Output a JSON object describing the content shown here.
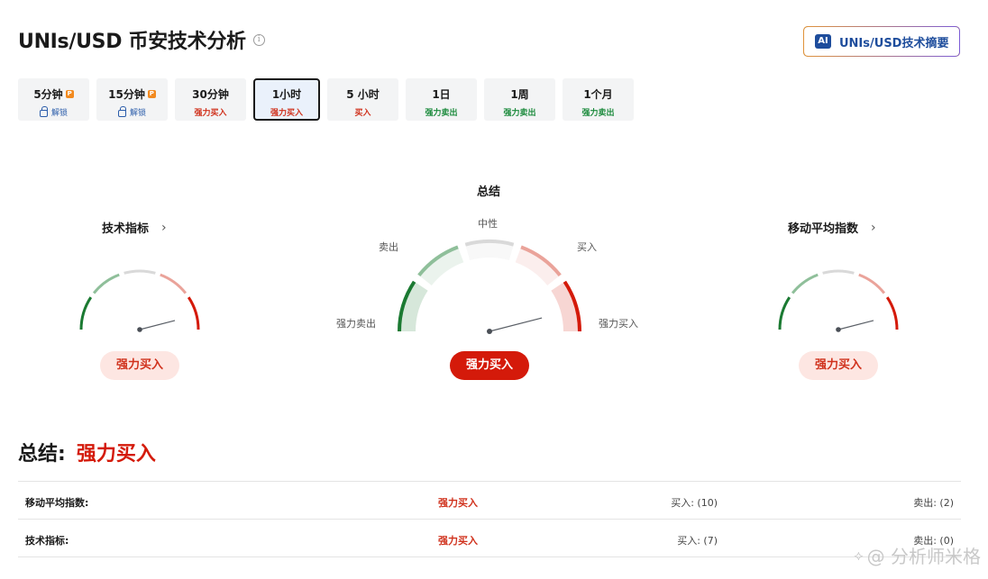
{
  "header": {
    "title": "UNIs/USD 币安技术分析",
    "info": "i"
  },
  "ai_button": {
    "badge": "AI",
    "label": "UNIs/USD技术摘要"
  },
  "tabs": [
    {
      "label": "5分钟",
      "status": "解锁",
      "pro": "P",
      "kind": "unlock"
    },
    {
      "label": "15分钟",
      "status": "解锁",
      "pro": "P",
      "kind": "unlock"
    },
    {
      "label": "30分钟",
      "status": "强力买入",
      "kind": "buy"
    },
    {
      "label": "1小时",
      "status": "强力买入",
      "kind": "buy",
      "active": true
    },
    {
      "label": "5 小时",
      "status": "买入",
      "kind": "buy"
    },
    {
      "label": "1日",
      "status": "强力卖出",
      "kind": "sell"
    },
    {
      "label": "1周",
      "status": "强力卖出",
      "kind": "sell"
    },
    {
      "label": "1个月",
      "status": "强力卖出",
      "kind": "sell"
    }
  ],
  "gauges": {
    "technical": {
      "title": "技术指标",
      "chevron": "›",
      "result": "强力买入",
      "level": 0.92
    },
    "summary": {
      "title": "总结",
      "labels": {
        "neutral": "中性",
        "sell": "卖出",
        "buy": "买入",
        "strong_sell": "强力卖出",
        "strong_buy": "强力买入"
      },
      "result": "强力买入",
      "level": 0.92
    },
    "moving_avg": {
      "title": "移动平均指数",
      "chevron": "›",
      "result": "强力买入",
      "level": 0.92
    }
  },
  "summary": {
    "label": "总结:",
    "value": "强力买入"
  },
  "table": [
    {
      "name": "移动平均指数:",
      "signal": "强力买入",
      "buy": "买入: (10)",
      "sell": "卖出: (2)"
    },
    {
      "name": "技术指标:",
      "signal": "强力买入",
      "buy": "买入: (7)",
      "sell": "卖出: (0)"
    }
  ],
  "watermark": "@ 分析师米格",
  "colors": {
    "strong_sell": "#1b7a32",
    "sell": "#8fbf9a",
    "neutral": "#d9d9d9",
    "buy": "#eaa39a",
    "strong_buy": "#d41a0a",
    "accent_blue": "#1e4d9c"
  }
}
